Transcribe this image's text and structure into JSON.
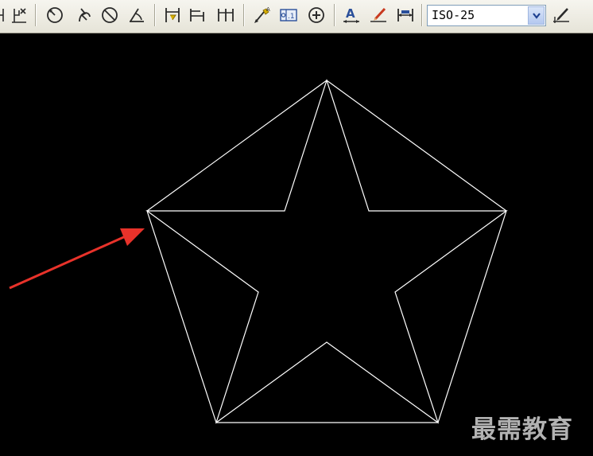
{
  "toolbar": {
    "buttons": [
      {
        "name": "dim-linear-icon"
      },
      {
        "name": "ordinate-icon"
      },
      {
        "name": "radius-icon"
      },
      {
        "name": "jogged-icon"
      },
      {
        "name": "diameter-icon"
      },
      {
        "name": "angular-icon"
      },
      {
        "name": "quick-dimension-icon"
      },
      {
        "name": "baseline-icon"
      },
      {
        "name": "continue-icon"
      },
      {
        "name": "quick-leader-icon"
      },
      {
        "name": "tolerance-icon"
      },
      {
        "name": "center-mark-icon"
      },
      {
        "name": "dimension-edit-icon"
      },
      {
        "name": "dimension-text-edit-icon"
      },
      {
        "name": "dimension-update-icon"
      },
      {
        "name": "dimension-style-icon"
      }
    ],
    "dim_style": {
      "value": "ISO-25"
    }
  },
  "watermark": "最需教育",
  "colors": {
    "canvas_bg": "#000000",
    "geometry": "#ffffff",
    "arrow": "#e8322a"
  }
}
